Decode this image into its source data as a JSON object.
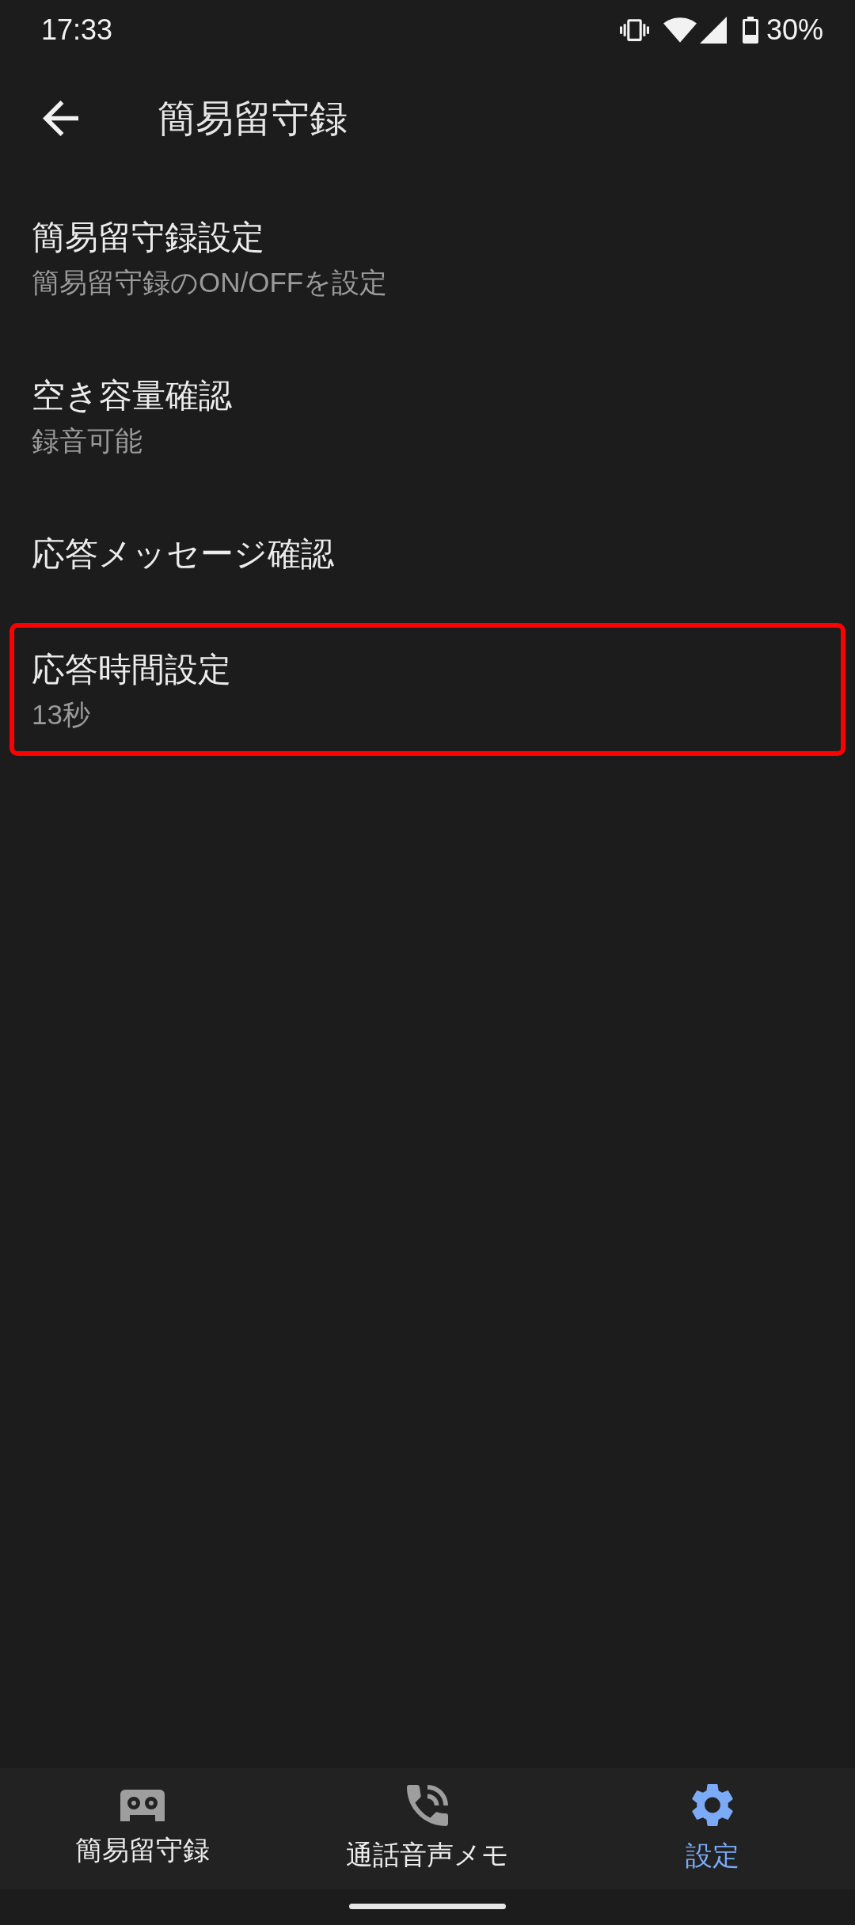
{
  "status_bar": {
    "time": "17:33",
    "battery": "30%"
  },
  "app_bar": {
    "title": "簡易留守録"
  },
  "settings": [
    {
      "title": "簡易留守録設定",
      "summary": "簡易留守録のON/OFFを設定",
      "highlighted": false
    },
    {
      "title": "空き容量確認",
      "summary": "録音可能",
      "highlighted": false
    },
    {
      "title": "応答メッセージ確認",
      "highlighted": false
    },
    {
      "title": "応答時間設定",
      "summary": "13秒",
      "highlighted": true
    }
  ],
  "bottom_nav": [
    {
      "label": "簡易留守録",
      "kind": "recorder",
      "selected": false
    },
    {
      "label": "通話音声メモ",
      "kind": "call",
      "selected": false
    },
    {
      "label": "設定",
      "kind": "settings",
      "selected": true
    }
  ]
}
